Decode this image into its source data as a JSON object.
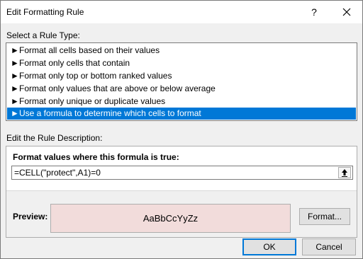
{
  "window": {
    "title": "Edit Formatting Rule",
    "help_label": "?",
    "close_label": "✕"
  },
  "rule_type": {
    "heading": "Select a Rule Type:",
    "items": [
      {
        "label": "Format all cells based on their values"
      },
      {
        "label": "Format only cells that contain"
      },
      {
        "label": "Format only top or bottom ranked values"
      },
      {
        "label": "Format only values that are above or below average"
      },
      {
        "label": "Format only unique or duplicate values"
      },
      {
        "label": "Use a formula to determine which cells to format"
      }
    ],
    "selected_index": 5,
    "arrow_glyph": "►"
  },
  "description": {
    "heading": "Edit the Rule Description:",
    "formula_label": "Format values where this formula is true:",
    "formula_value": "=CELL(\"protect\",A1)=0",
    "collapse_icon": "↑",
    "preview_label": "Preview:",
    "preview_text": "AaBbCcYyZz",
    "preview_fill": "#f2dcdb",
    "format_button": "Format..."
  },
  "footer": {
    "ok_label": "OK",
    "cancel_label": "Cancel"
  },
  "colors": {
    "selection": "#0078d7",
    "dialog_bg": "#f0f0f0"
  }
}
